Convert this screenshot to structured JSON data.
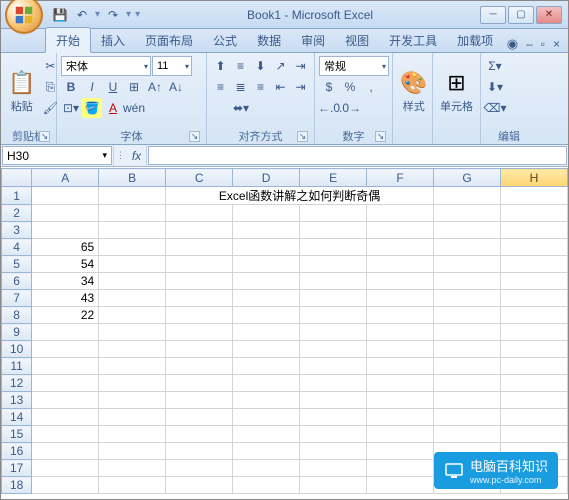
{
  "title": "Book1 - Microsoft Excel",
  "qat": {
    "save": "💾",
    "undo": "↶",
    "redo": "↷"
  },
  "tabs": [
    "开始",
    "插入",
    "页面布局",
    "公式",
    "数据",
    "审阅",
    "视图",
    "开发工具",
    "加载项"
  ],
  "active_tab": 0,
  "ribbon": {
    "clipboard": {
      "label": "剪贴板",
      "paste": "粘贴"
    },
    "font": {
      "label": "字体",
      "name": "宋体",
      "size": "11"
    },
    "align": {
      "label": "对齐方式"
    },
    "number": {
      "label": "数字",
      "format": "常规"
    },
    "styles": {
      "label": "样式"
    },
    "cells": {
      "label": "单元格"
    },
    "edit": {
      "label": "编辑"
    }
  },
  "namebox": "H30",
  "formula": "",
  "columns": [
    "A",
    "B",
    "C",
    "D",
    "E",
    "F",
    "G",
    "H"
  ],
  "selected_col": "H",
  "rows": 18,
  "cells": {
    "title_row": {
      "col": "C",
      "span": 4,
      "text": "Excel函数讲解之如何判断奇偶"
    },
    "data": [
      {
        "r": 4,
        "c": "A",
        "v": "65"
      },
      {
        "r": 5,
        "c": "A",
        "v": "54"
      },
      {
        "r": 6,
        "c": "A",
        "v": "34"
      },
      {
        "r": 7,
        "c": "A",
        "v": "43"
      },
      {
        "r": 8,
        "c": "A",
        "v": "22"
      }
    ]
  },
  "watermark": {
    "main": "电脑百科知识",
    "sub": "www.pc-daily.com"
  }
}
